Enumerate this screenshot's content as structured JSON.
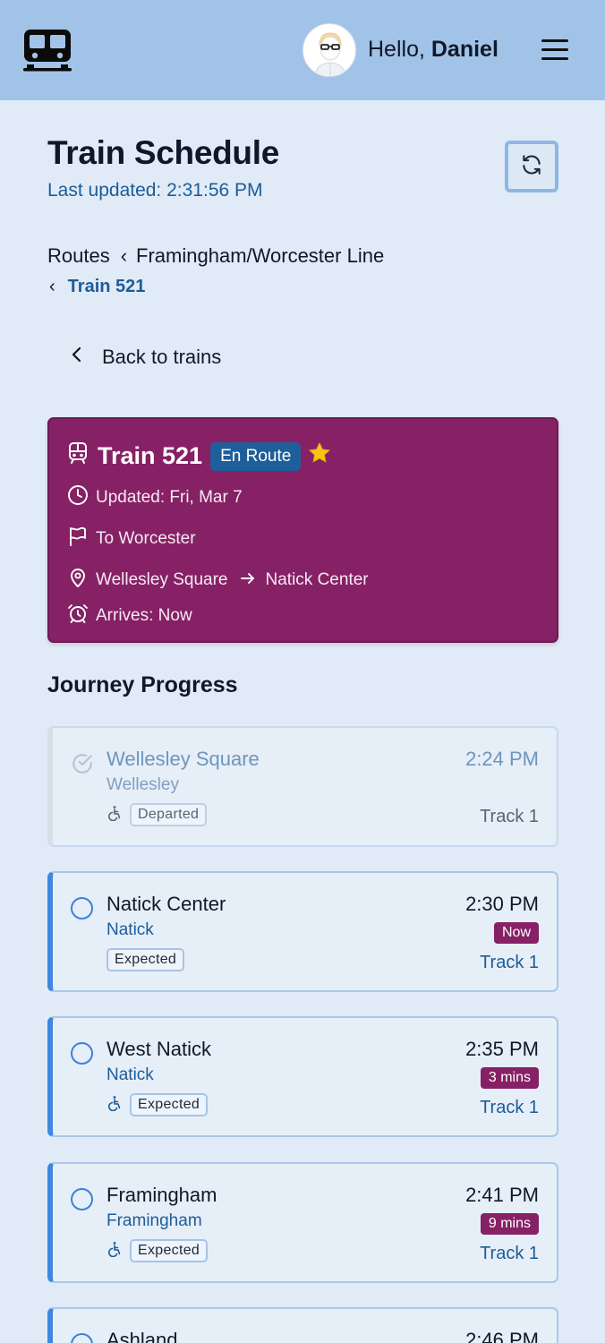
{
  "header": {
    "greeting_prefix": "Hello,",
    "user_name": "Daniel"
  },
  "page": {
    "title": "Train Schedule",
    "last_updated": "Last updated: 2:31:56 PM"
  },
  "breadcrumb": {
    "root": "Routes",
    "line": "Framingham/Worcester Line",
    "train": "Train 521"
  },
  "back_link": "Back to trains",
  "train_card": {
    "title": "Train 521",
    "status_badge": "En Route",
    "favorite": true,
    "updated": "Updated: Fri, Mar 7",
    "destination": "To Worcester",
    "from_station": "Wellesley Square",
    "to_station": "Natick Center",
    "arrives": "Arrives: Now"
  },
  "journey": {
    "title": "Journey Progress",
    "stops": [
      {
        "name": "Wellesley Square",
        "town": "Wellesley",
        "status": "Departed",
        "time": "2:24 PM",
        "eta": "",
        "track": "Track 1",
        "accessible": true,
        "departed": true
      },
      {
        "name": "Natick Center",
        "town": "Natick",
        "status": "Expected",
        "time": "2:30 PM",
        "eta": "Now",
        "track": "Track 1",
        "accessible": false,
        "departed": false
      },
      {
        "name": "West Natick",
        "town": "Natick",
        "status": "Expected",
        "time": "2:35 PM",
        "eta": "3 mins",
        "track": "Track 1",
        "accessible": true,
        "departed": false
      },
      {
        "name": "Framingham",
        "town": "Framingham",
        "status": "Expected",
        "time": "2:41 PM",
        "eta": "9 mins",
        "track": "Track 1",
        "accessible": true,
        "departed": false
      },
      {
        "name": "Ashland",
        "time": "2:46 PM"
      }
    ]
  },
  "colors": {
    "header_bg": "#a2c3e8",
    "page_bg": "#e1ebf7",
    "train_card_bg": "#862165",
    "accent_blue": "#1d5c97",
    "stop_border_active": "#3f86df"
  }
}
